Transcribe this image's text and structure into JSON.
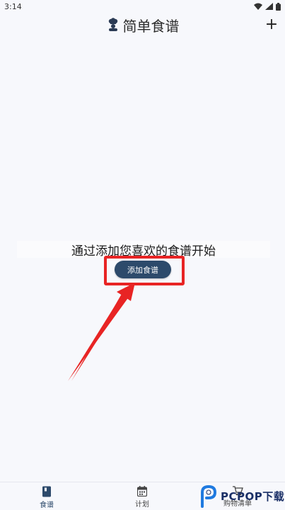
{
  "status_bar": {
    "time": "3:14"
  },
  "app_bar": {
    "title": "简单食谱",
    "add_symbol": "+"
  },
  "empty_state": {
    "message": "通过添加您喜欢的食谱开始",
    "button_label": "添加食谱"
  },
  "bottom_nav": {
    "items": [
      {
        "label": "食谱",
        "icon": "book-icon",
        "active": true
      },
      {
        "label": "计划",
        "icon": "calendar-icon",
        "active": false
      },
      {
        "label": "购物清单",
        "icon": "cart-icon",
        "active": false
      }
    ]
  },
  "watermark": {
    "text": "PCPOP下载"
  },
  "colors": {
    "accent": "#2d4a6b",
    "highlight": "#e82424",
    "background": "#f7f8fc"
  }
}
